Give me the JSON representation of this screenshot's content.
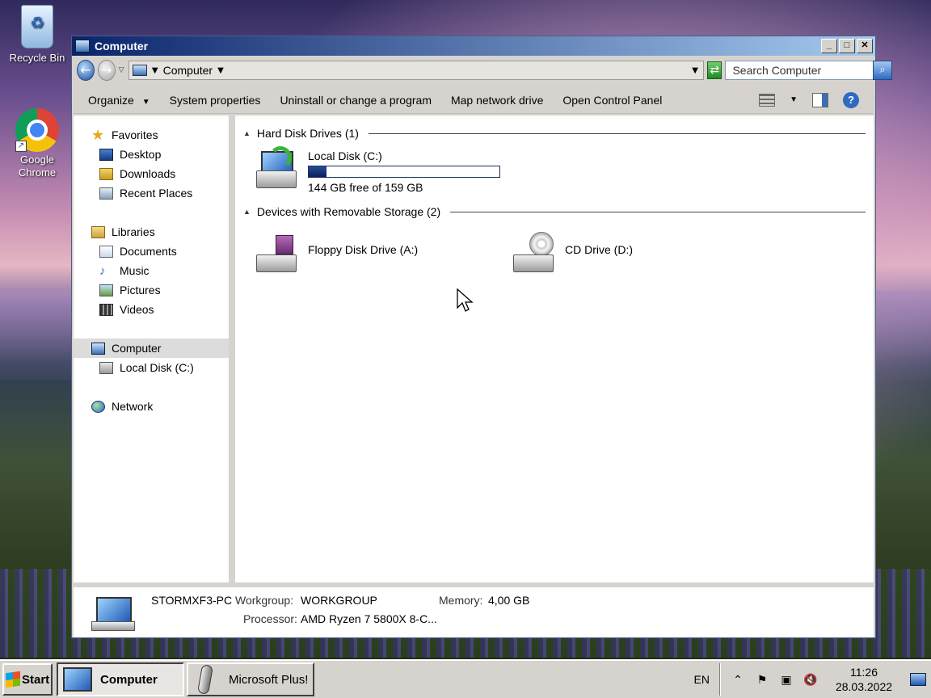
{
  "desktop": {
    "icons": [
      {
        "label": "Recycle Bin"
      },
      {
        "label": "Google Chrome"
      }
    ]
  },
  "window": {
    "title": "Computer",
    "address": {
      "location": "Computer"
    },
    "search": {
      "placeholder": "Search Computer"
    },
    "commandbar": {
      "organize": "Organize",
      "system_properties": "System properties",
      "uninstall": "Uninstall or change a program",
      "map_drive": "Map network drive",
      "control_panel": "Open Control Panel"
    },
    "navpane": {
      "favorites": "Favorites",
      "desktop": "Desktop",
      "downloads": "Downloads",
      "recent_places": "Recent Places",
      "libraries": "Libraries",
      "documents": "Documents",
      "music": "Music",
      "pictures": "Pictures",
      "videos": "Videos",
      "computer": "Computer",
      "local_disk": "Local Disk (C:)",
      "network": "Network"
    },
    "content": {
      "hdd_group": "Hard Disk Drives (1)",
      "removable_group": "Devices with Removable Storage (2)",
      "drives": {
        "c": {
          "name": "Local Disk (C:)",
          "free_text": "144 GB free of 159 GB",
          "used_fraction": 0.094
        },
        "a": {
          "name": "Floppy Disk Drive (A:)"
        },
        "d": {
          "name": "CD Drive (D:)"
        }
      }
    },
    "details": {
      "computer_name": "STORMXF3-PC",
      "workgroup_label": "Workgroup:",
      "workgroup_value": "WORKGROUP",
      "memory_label": "Memory:",
      "memory_value": "4,00 GB",
      "processor_label": "Processor:",
      "processor_value": "AMD Ryzen 7 5800X 8-C..."
    }
  },
  "taskbar": {
    "start": "Start",
    "tasks": [
      {
        "label": "Computer",
        "active": true
      },
      {
        "label": "Microsoft Plus!",
        "active": false
      }
    ],
    "tray": {
      "language": "EN",
      "time": "11:26",
      "date": "28.03.2022"
    }
  }
}
